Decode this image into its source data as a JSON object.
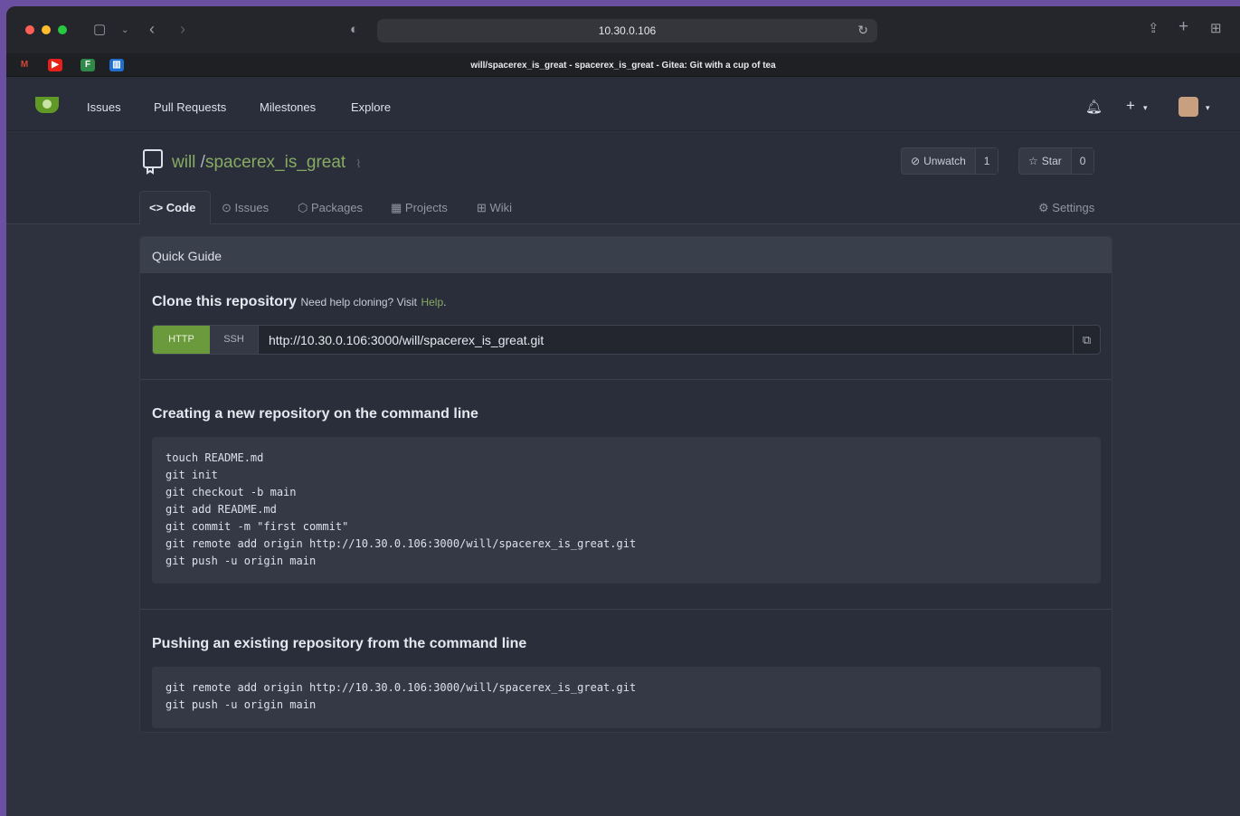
{
  "browser": {
    "url": "10.30.0.106",
    "tab_title": "will/spacerex_is_great - spacerex_is_great - Gitea: Git with a cup of tea"
  },
  "favorites": [
    {
      "icon": "gmail-icon",
      "letter": "M",
      "color": "#d44638"
    },
    {
      "icon": "youtube-icon",
      "letter": "▶",
      "color": "#e62117"
    },
    {
      "icon": "green-app-icon",
      "letter": "F",
      "color": "#2f8a4a"
    },
    {
      "icon": "trello-icon",
      "letter": "▥",
      "color": "#1f6fd1"
    }
  ],
  "nav": {
    "items": [
      "Issues",
      "Pull Requests",
      "Milestones",
      "Explore"
    ]
  },
  "repo": {
    "owner": "will",
    "separator": "/",
    "name": "spacerex_is_great",
    "unwatch_label": "Unwatch",
    "watch_count": "1",
    "star_label": "Star",
    "star_count": "0",
    "tabs": [
      "Code",
      "Issues",
      "Packages",
      "Projects",
      "Wiki"
    ],
    "settings_label": "Settings"
  },
  "guide": {
    "header": "Quick Guide",
    "clone_title": "Clone this repository",
    "clone_sub": "Need help cloning? Visit",
    "clone_help": "Help",
    "clone_period": ".",
    "http_label": "HTTP",
    "ssh_label": "SSH",
    "clone_url": "http://10.30.0.106:3000/will/spacerex_is_great.git",
    "new_repo_title": "Creating a new repository on the command line",
    "new_repo_code": "touch README.md\ngit init\ngit checkout -b main\ngit add README.md\ngit commit -m \"first commit\"\ngit remote add origin http://10.30.0.106:3000/will/spacerex_is_great.git\ngit push -u origin main",
    "push_title": "Pushing an existing repository from the command line",
    "push_code": "git remote add origin http://10.30.0.106:3000/will/spacerex_is_great.git\ngit push -u origin main"
  },
  "colors": {
    "accent_green": "#609926",
    "link_green": "#87ab63",
    "background": "#2e323e"
  }
}
